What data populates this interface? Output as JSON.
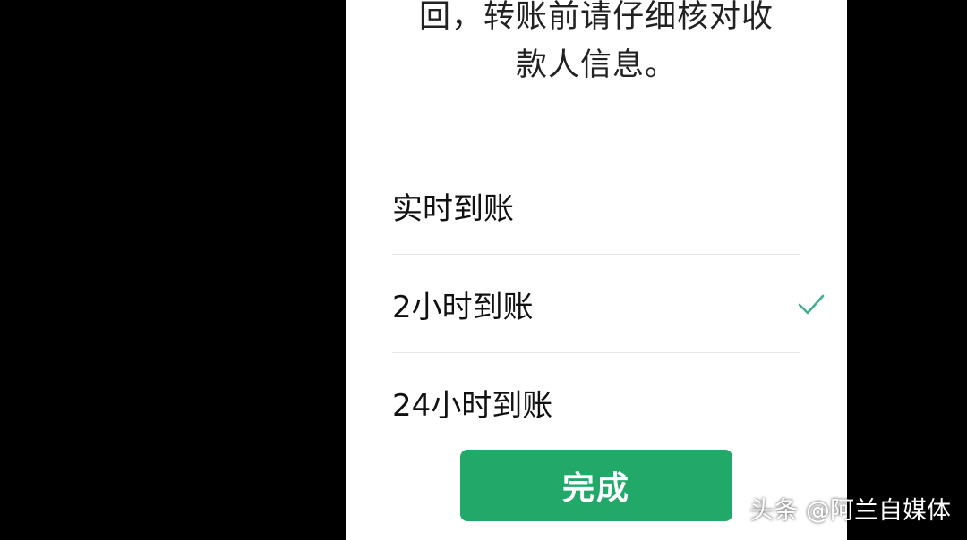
{
  "dialog": {
    "description_lines": [
      "回，转账前请仔细核对收",
      "款人信息。"
    ]
  },
  "options": [
    {
      "label": "实时到账",
      "selected": false
    },
    {
      "label": "2小时到账",
      "selected": true
    },
    {
      "label": "24小时到账",
      "selected": false
    }
  ],
  "done_button": {
    "label": "完成"
  },
  "watermark": {
    "text": "头条 @阿兰自媒体"
  },
  "colors": {
    "accent": "#22a96a",
    "check": "#3fae8a"
  },
  "icons": {
    "selected_marker": "check-icon"
  }
}
